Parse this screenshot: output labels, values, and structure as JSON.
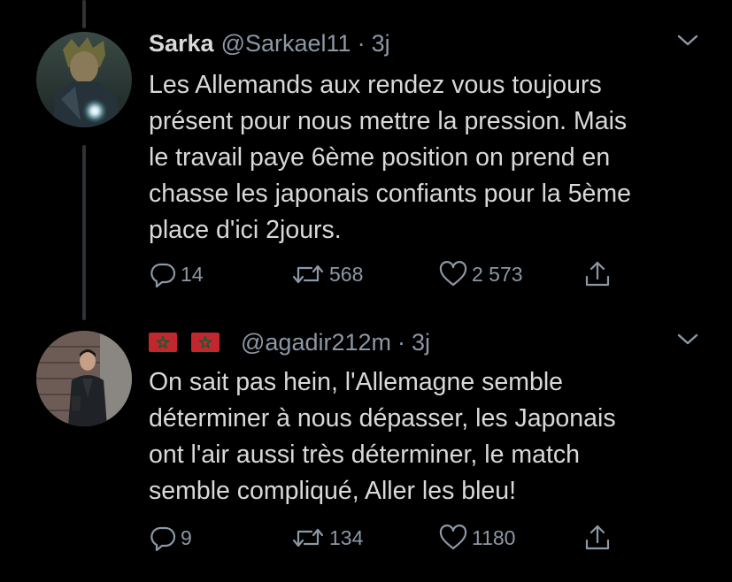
{
  "tweets": [
    {
      "display_name": "Sarka",
      "handle": "@Sarkael11",
      "separator": "·",
      "time": "3j",
      "text": "Les Allemands aux rendez vous toujours\nprésent pour nous mettre la pression. Mais\nle travail paye 6ème position on prend en\nchasse les japonais confiants pour la 5ème\nplace d'ici 2jours.",
      "replies": "14",
      "retweets": "568",
      "likes": "2 573"
    },
    {
      "display_name_flags": [
        "morocco-flag",
        "morocco-flag"
      ],
      "handle": "@agadir212m",
      "separator": "·",
      "time": "3j",
      "text": "On sait pas hein, l'Allemagne semble\ndéterminer à nous dépasser, les Japonais\nont l'air aussi très déterminer, le match\nsemble compliqué, Aller les bleu!",
      "replies": "9",
      "retweets": "134",
      "likes": "1180"
    }
  ],
  "colors": {
    "background": "#000000",
    "text": "#d9d9d9",
    "secondary": "#8b98a5",
    "thread_line": "#2f3336",
    "flag_red": "#c1272d",
    "flag_star": "#006233"
  }
}
